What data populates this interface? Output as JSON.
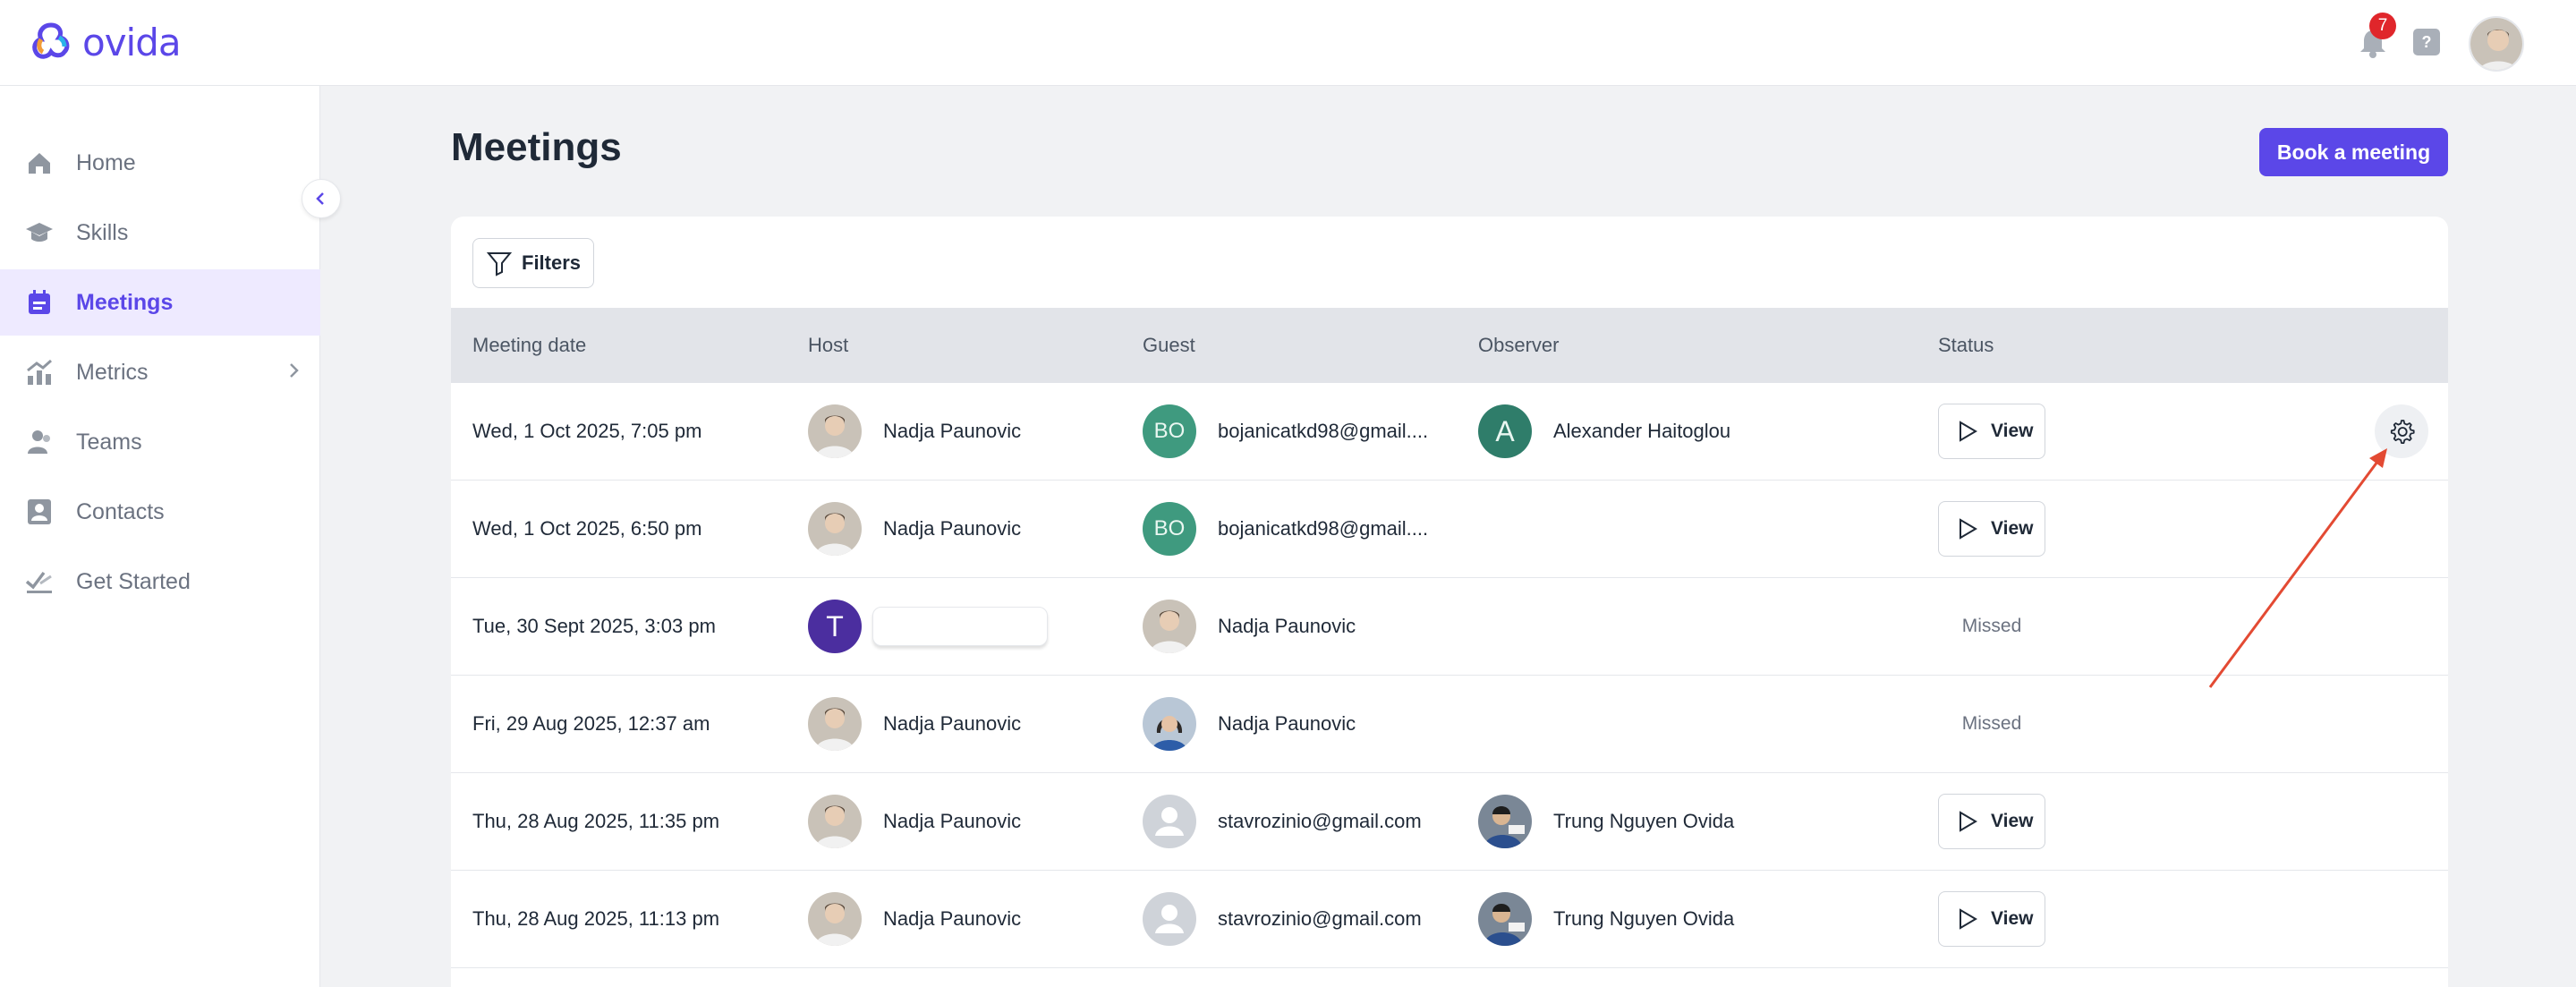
{
  "app": {
    "name": "ovida"
  },
  "header": {
    "notification_count": "7",
    "help_label": "?"
  },
  "sidebar": {
    "items": [
      {
        "label": "Home",
        "icon": "home-icon",
        "active": false
      },
      {
        "label": "Skills",
        "icon": "graduation-cap-icon",
        "active": false
      },
      {
        "label": "Meetings",
        "icon": "calendar-icon",
        "active": true
      },
      {
        "label": "Metrics",
        "icon": "chart-icon",
        "active": false,
        "has_submenu": true
      },
      {
        "label": "Teams",
        "icon": "people-icon",
        "active": false
      },
      {
        "label": "Contacts",
        "icon": "contact-card-icon",
        "active": false
      },
      {
        "label": "Get Started",
        "icon": "checklist-icon",
        "active": false
      }
    ]
  },
  "page": {
    "title": "Meetings",
    "book_button": "Book a meeting",
    "filters_button": "Filters"
  },
  "table": {
    "columns": [
      "Meeting date",
      "Host",
      "Guest",
      "Observer",
      "Status"
    ],
    "rows": [
      {
        "date": "Wed, 1 Oct 2025, 7:05 pm",
        "host": "Nadja Paunovic",
        "guest_initials": "BO",
        "guest": "bojanicatkd98@gmail....",
        "observer_initial": "A",
        "observer": "Alexander Haitoglou",
        "status": "View",
        "has_settings": true
      },
      {
        "date": "Wed, 1 Oct 2025, 6:50 pm",
        "host": "Nadja Paunovic",
        "guest_initials": "BO",
        "guest": "bojanicatkd98@gmail....",
        "observer": "",
        "status": "View"
      },
      {
        "date": "Tue, 30 Sept 2025, 3:03 pm",
        "host_initial": "T",
        "host": "",
        "guest": "Nadja Paunovic",
        "observer": "",
        "status": "Missed"
      },
      {
        "date": "Fri, 29 Aug 2025, 12:37 am",
        "host": "Nadja Paunovic",
        "guest": "Nadja Paunovic",
        "observer": "",
        "status": "Missed"
      },
      {
        "date": "Thu, 28 Aug 2025, 11:35 pm",
        "host": "Nadja Paunovic",
        "guest": "stavrozinio@gmail.com",
        "observer": "Trung Nguyen Ovida",
        "status": "View"
      },
      {
        "date": "Thu, 28 Aug 2025, 11:13 pm",
        "host": "Nadja Paunovic",
        "guest": "stavrozinio@gmail.com",
        "observer": "Trung Nguyen Ovida",
        "status": "View"
      }
    ]
  },
  "colors": {
    "accent": "#5b47e8",
    "annotation_arrow": "#e34a33",
    "badge": "#e0262b"
  }
}
